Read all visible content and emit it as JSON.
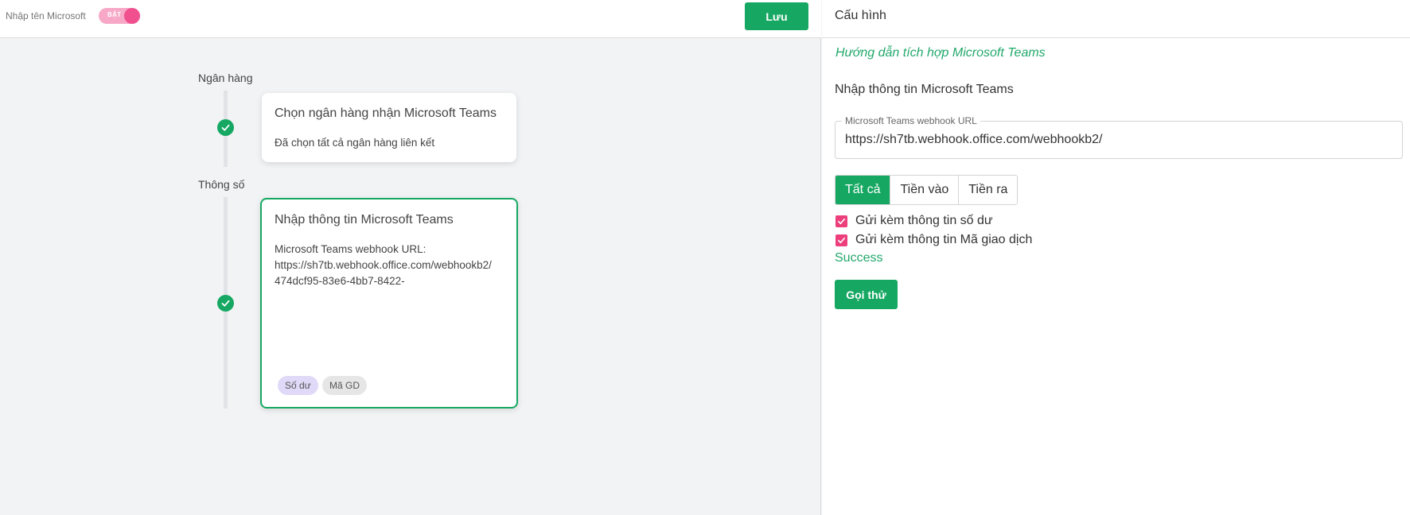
{
  "topbar": {
    "name_placeholder": "Nhập tên Microsoft",
    "toggle_label": "BẬT",
    "save_label": "Lưu"
  },
  "steps": [
    {
      "section": "Ngân hàng",
      "card_title": "Chọn ngân hàng nhận Microsoft Teams",
      "card_desc": "Đã chọn tất cả ngân hàng liên kết",
      "status_icon": "check-circle-icon"
    },
    {
      "section": "Thông số",
      "card_title": "Nhập thông tin Microsoft Teams",
      "card_desc_lines": [
        "Microsoft Teams webhook URL:",
        "https://sh7tb.webhook.office.com/webhookb2/",
        "474dcf95-83e6-4bb7-8422-"
      ],
      "tags": [
        "Số dư",
        "Mã GD"
      ],
      "status_icon": "check-circle-icon"
    }
  ],
  "config": {
    "title": "Cấu hình",
    "guide_link": "Hướng dẫn tích hợp Microsoft Teams",
    "subtitle": "Nhập thông tin Microsoft Teams",
    "webhook_label": "Microsoft Teams webhook URL",
    "webhook_value": "https://sh7tb.webhook.office.com/webhookb2/",
    "filters": [
      "Tất cả",
      "Tiền vào",
      "Tiền ra"
    ],
    "selected_filter": "Tất cả",
    "options": [
      {
        "label": "Gửi kèm thông tin số dư",
        "checked": true
      },
      {
        "label": "Gửi kèm thông tin Mã giao dịch",
        "checked": true
      }
    ],
    "status": "Success",
    "test_label": "Gọi thử"
  },
  "colors": {
    "primary": "#16a862",
    "accent_pink": "#ec3f7b",
    "link_green": "#22a86b",
    "tag_purple": "#e0d9f7"
  }
}
